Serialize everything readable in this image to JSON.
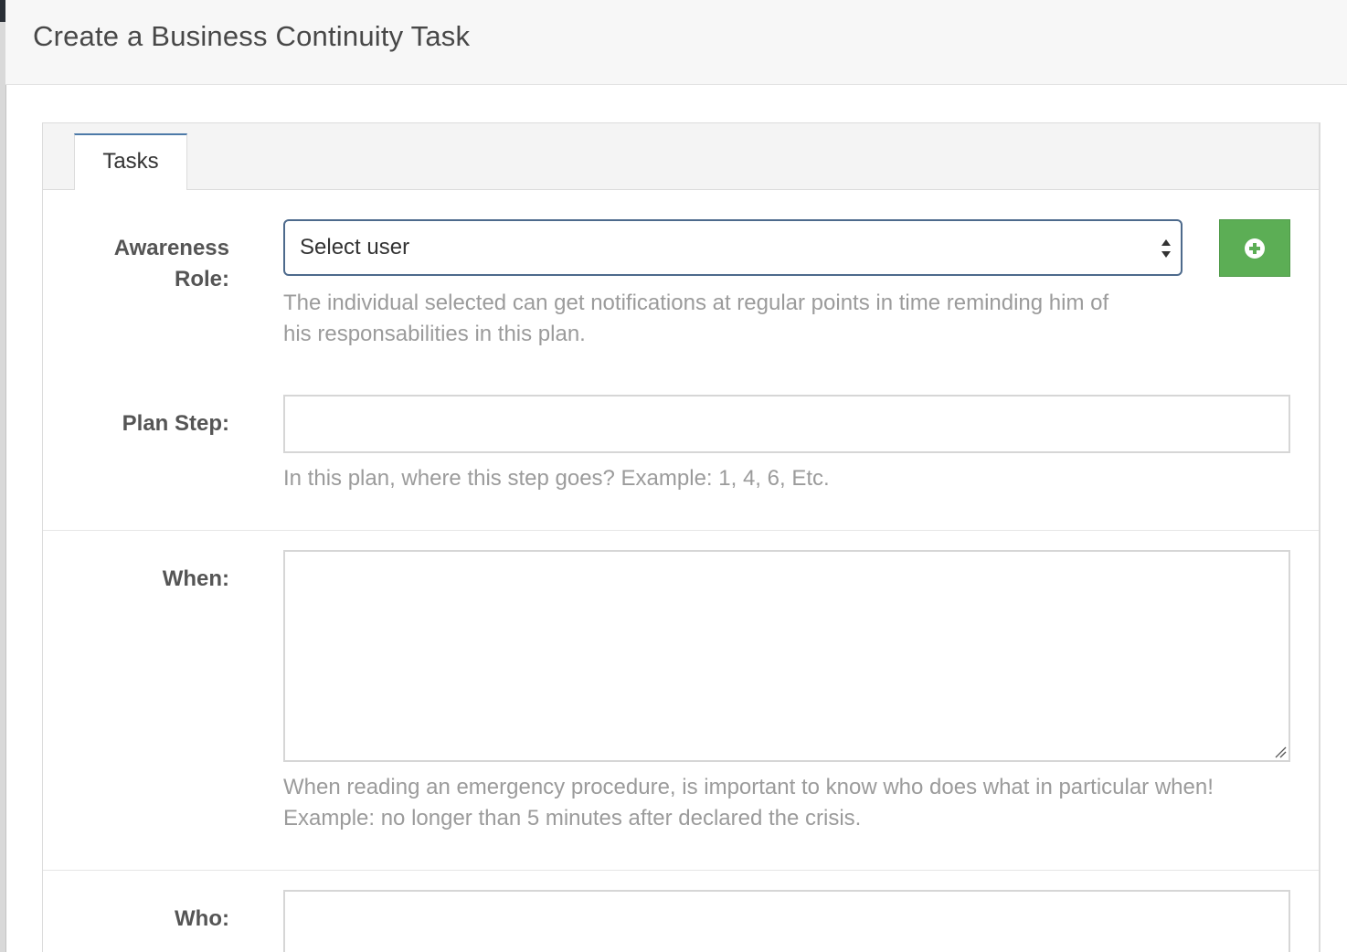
{
  "header": {
    "title": "Create a Business Continuity Task"
  },
  "tabs": [
    {
      "label": "Tasks",
      "active": true
    }
  ],
  "form": {
    "awareness_role": {
      "label_line1": "Awareness",
      "label_line2": "Role:",
      "selected_value": "Select user",
      "help_line1": "The individual selected can get notifications at regular points in time reminding him of",
      "help_line2": "his responsabilities in this plan.",
      "add_icon": "plus-circle-icon"
    },
    "plan_step": {
      "label": "Plan Step:",
      "value": "",
      "help": "In this plan, where this step goes? Example: 1, 4, 6, Etc."
    },
    "when": {
      "label": "When:",
      "value": "",
      "help_line1": "When reading an emergency procedure, is important to know who does what in particular when!",
      "help_line2": "Example: no longer than 5 minutes after declared the crisis."
    },
    "who": {
      "label": "Who:",
      "value": ""
    }
  },
  "colors": {
    "add_button": "#5cae55",
    "tab_accent": "#4d7aa8",
    "select_border": "#4d6a8c",
    "help_text": "#9b9b9b"
  }
}
